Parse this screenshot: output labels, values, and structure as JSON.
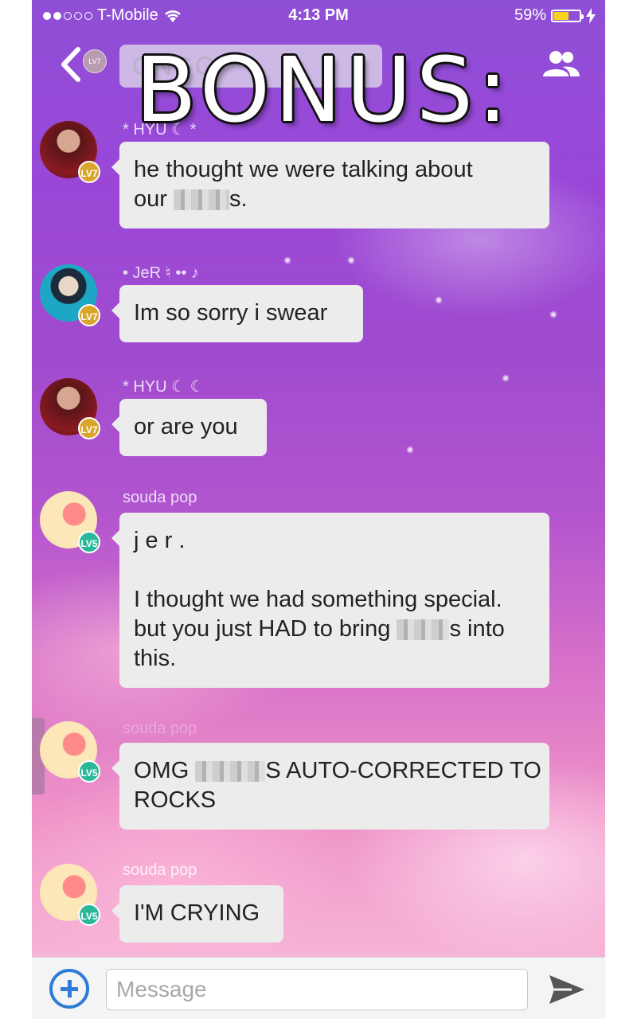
{
  "status_bar": {
    "carrier": "T-Mobile",
    "time": "4:13 PM",
    "battery_percent": "59%",
    "battery_level": 0.59,
    "signal_bars_filled": 2,
    "battery_color": "#f6d21e"
  },
  "header": {
    "title": "ONGG",
    "avatar_badge": "LV7",
    "overlay_text": "BONUS:",
    "back_icon": "chevron-left-icon",
    "members_icon": "people-icon"
  },
  "messages": [
    {
      "sender": "* HYU ☾ *",
      "level": "LV7",
      "avatar": "hyu",
      "lines": [
        {
          "before": "he thought we were talking about",
          "after": ""
        },
        {
          "before": "our ",
          "after": "s."
        }
      ]
    },
    {
      "sender": "• JeR ♮ •• ♪",
      "level": "LV7",
      "avatar": "jer",
      "lines": [
        {
          "before": "Im so sorry i swear",
          "after": ""
        }
      ]
    },
    {
      "sender": "* HYU ☾   ☾",
      "level": "LV7",
      "avatar": "hyu",
      "lines": [
        {
          "before": "or are you",
          "after": ""
        }
      ]
    },
    {
      "sender": "souda pop",
      "level": "LV5",
      "avatar": "souda",
      "lines": [
        {
          "before": "j e r .",
          "after": ""
        },
        {
          "before": "",
          "after": ""
        },
        {
          "before": "I thought we had something special.",
          "after": ""
        },
        {
          "before": "but you just HAD to bring ",
          "after": "s into"
        },
        {
          "before": "this.",
          "after": ""
        }
      ]
    },
    {
      "sender": "souda pop",
      "level": "LV5",
      "avatar": "souda",
      "lines": [
        {
          "before": "OMG ",
          "after": "S AUTO-CORRECTED TO"
        },
        {
          "before": "ROCKS",
          "after": ""
        }
      ]
    },
    {
      "sender": "souda pop",
      "level": "LV5",
      "avatar": "souda",
      "lines": [
        {
          "before": "I'M CRYING",
          "after": ""
        }
      ]
    }
  ],
  "input_bar": {
    "placeholder": "Message",
    "value": "",
    "add_icon": "plus-circle-icon",
    "send_icon": "send-icon",
    "accent": "#2e7cd6"
  }
}
